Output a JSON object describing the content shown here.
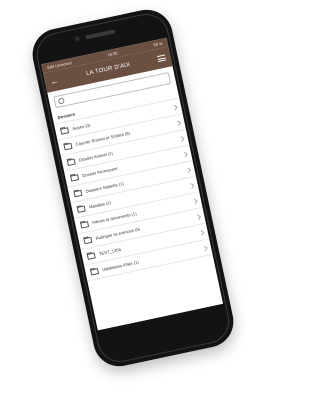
{
  "status": {
    "carrier": "SIM Unlocked",
    "time": "16:30",
    "battery": "59 %"
  },
  "header": {
    "title": "LA TOUR D'AIX"
  },
  "search": {
    "placeholder": ""
  },
  "section": {
    "title": "Dossiers"
  },
  "folders": [
    {
      "label": "Autres (3)"
    },
    {
      "label": "Courrier Entrant et Sortant (5)"
    },
    {
      "label": "Dossier Annuel (1)"
    },
    {
      "label": "Dossier Permanent"
    },
    {
      "label": "Dossiers Salariés (1)"
    },
    {
      "label": "Mandats (1)"
    },
    {
      "label": "Pièces et documents (1)"
    },
    {
      "label": "Rubrique ss exercice (5)"
    },
    {
      "label": "TEST_1204"
    },
    {
      "label": "Validations IPaie (1)"
    }
  ],
  "colors": {
    "header": "#6b4f41",
    "phone_body": "#131313"
  }
}
